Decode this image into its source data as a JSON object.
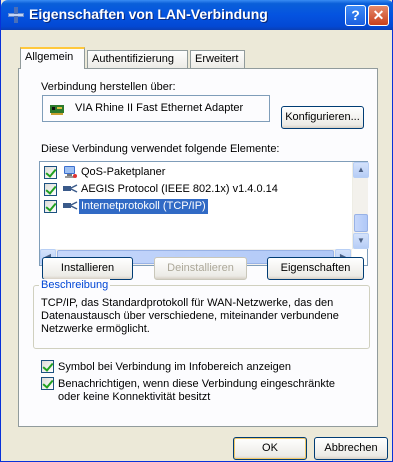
{
  "window": {
    "title": "Eigenschaften von LAN-Verbindung",
    "help": "?",
    "close": "✕"
  },
  "tabs": [
    {
      "label": "Allgemein",
      "active": true
    },
    {
      "label": "Authentifizierung",
      "active": false
    },
    {
      "label": "Erweitert",
      "active": false
    }
  ],
  "connection": {
    "label": "Verbindung herstellen über:",
    "adapter": "VIA Rhine II Fast Ethernet Adapter",
    "configure_button": "Konfigurieren..."
  },
  "components": {
    "label": "Diese Verbindung verwendet folgende Elemente:",
    "items": [
      {
        "name": "QoS-Paketplaner",
        "checked": true,
        "icon": "qos-scheduler-icon",
        "selected": false
      },
      {
        "name": "AEGIS Protocol (IEEE 802.1x) v1.4.0.14",
        "checked": true,
        "icon": "network-protocol-icon",
        "selected": false
      },
      {
        "name": "Internetprotokoll (TCP/IP)",
        "checked": true,
        "icon": "network-protocol-icon",
        "selected": true
      }
    ]
  },
  "buttons": {
    "install": "Installieren",
    "uninstall": "Deinstallieren",
    "properties": "Eigenschaften",
    "ok": "OK",
    "cancel": "Abbrechen"
  },
  "description": {
    "title": "Beschreibung",
    "text": "TCP/IP, das Standardprotokoll für WAN-Netzwerke, das den Datenaustausch über verschiedene, miteinander verbundene Netzwerke ermöglicht."
  },
  "options": [
    {
      "label": "Symbol bei Verbindung im Infobereich anzeigen",
      "checked": true
    },
    {
      "label": "Benachrichtigen, wenn diese Verbindung eingeschränkte oder keine Konnektivität besitzt",
      "checked": true
    }
  ],
  "colors": {
    "titlebar": "#0453e0",
    "selection": "#316ac5",
    "face": "#ece9d8",
    "groupbox_title": "#0046d5"
  }
}
